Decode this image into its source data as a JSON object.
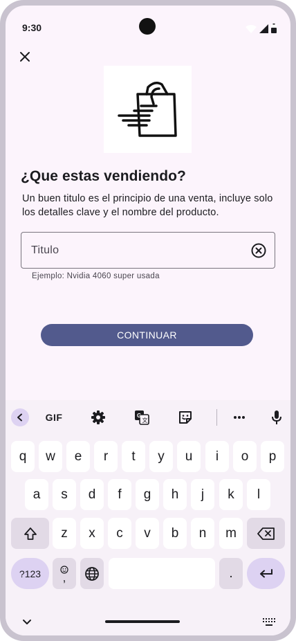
{
  "status_bar": {
    "time": "9:30",
    "icons": [
      "wifi-icon",
      "signal-icon",
      "battery-icon"
    ]
  },
  "header": {
    "close_icon": "close-icon"
  },
  "hero": {
    "image": "shopping-bag-fast-icon"
  },
  "content": {
    "title": "¿Que estas vendiendo?",
    "subtitle": "Un buen titulo es el principio de una venta, incluye solo los detalles clave y el nombre del producto.",
    "input_value": "",
    "input_placeholder": "Titulo",
    "helper_text": "Ejemplo: Nvidia 4060 super usada",
    "continue_label": "CONTINUAR"
  },
  "keyboard": {
    "toolbar": {
      "gif_label": "GIF",
      "icons": [
        "chevron-left-icon",
        "gear-icon",
        "translate-icon",
        "sticker-icon",
        "more-icon",
        "mic-icon"
      ]
    },
    "row1": [
      "q",
      "w",
      "e",
      "r",
      "t",
      "y",
      "u",
      "i",
      "o",
      "p"
    ],
    "row2": [
      "a",
      "s",
      "d",
      "f",
      "g",
      "h",
      "j",
      "k",
      "l"
    ],
    "row3": [
      "z",
      "x",
      "c",
      "v",
      "b",
      "n",
      "m"
    ],
    "symbols_label": "?123",
    "emoji_comma_label": ",",
    "period_label": ".",
    "colors": {
      "accent": "#ddd2f2",
      "func": "#e2dae6",
      "key": "#ffffff",
      "background": "#f7f1f8"
    }
  },
  "colors": {
    "primary_button": "#525a8d",
    "screen_background": "#fcf4fc"
  }
}
